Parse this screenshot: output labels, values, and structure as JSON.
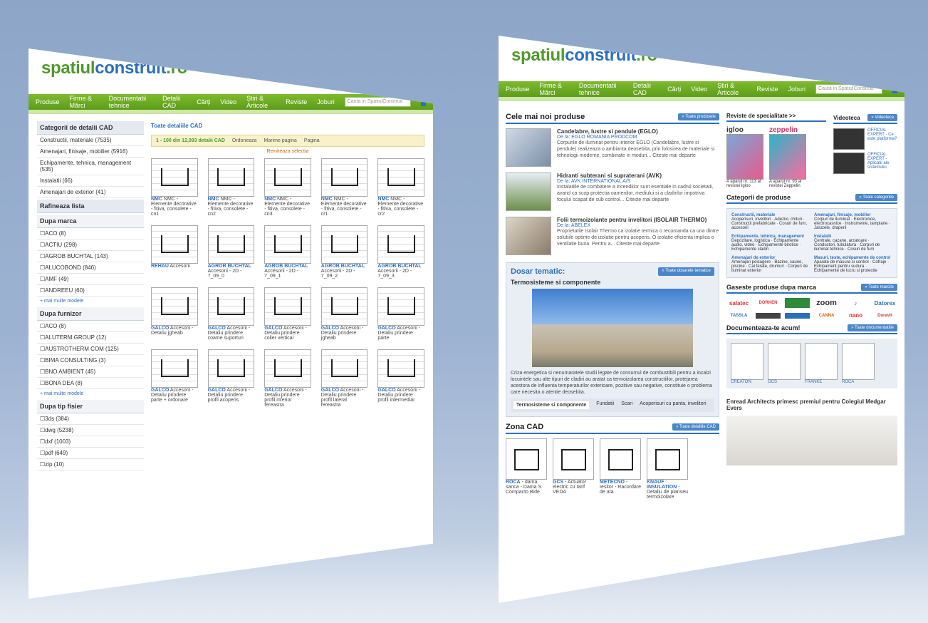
{
  "left": {
    "logo_a": "spatiul",
    "logo_b": "construit",
    "logo_c": ".ro",
    "nav": [
      "Produse",
      "Firme & Mărci",
      "Documentatii tehnice",
      "Detalii CAD",
      "Cărți",
      "Video",
      "Știri & Articole",
      "Reviste",
      "Joburi"
    ],
    "search_placeholder": "Cauta in SpatiulConstruit",
    "sidebar_title": "Categorii de detalii CAD",
    "categories": [
      "Constructii, materiale (7535)",
      "Amenajari, finisaje, mobilier (5916)",
      "Echipamente, tehnica, management (535)",
      "Instalatii (66)",
      "Amenajari de exterior (41)"
    ],
    "refine_title": "Rafineaza lista",
    "by_brand_title": "Dupa marca",
    "brands": [
      "ACO (8)",
      "ACTIU (298)",
      "AGROB BUCHTAL (143)",
      "ALUCOBOND (846)",
      "AMF (49)",
      "ANDREEU (60)"
    ],
    "more": "+ mai multe modele",
    "by_supplier_title": "Dupa furnizor",
    "suppliers": [
      "ACO (8)",
      "ALUTERM GROUP (12)",
      "AUSTROTHERM COM (125)",
      "BIMA CONSULTING (3)",
      "BNO AMBIENT (45)",
      "BONA DEA (8)"
    ],
    "by_filetype_title": "Dupa tip fisier",
    "filetypes": [
      "3ds (384)",
      "dwg (5238)",
      "dxf (1003)",
      "pdf (649)",
      "zip (10)"
    ],
    "crumb": "Toate detaliile CAD",
    "filter_text": "1 - 100 din 12,093 detalii CAD",
    "order_label": "Ordoneaza",
    "results_label": "Marime pagina",
    "page_label": "Pagina",
    "reset": "Reiniteaza selectia",
    "cad_items": [
      {
        "name": "NMC",
        "desc": "NMC - Elemente decorative - fitiva, consolete - cn1"
      },
      {
        "name": "NMC",
        "desc": "NMC - Elemente decorative - fitiva, consolete - cn2"
      },
      {
        "name": "NMC",
        "desc": "NMC - Elemente decorative - fitiva, consolete - cn3"
      },
      {
        "name": "NMC",
        "desc": "NMC - Elemente decorative - fitiva, consolete - cr1"
      },
      {
        "name": "NMC",
        "desc": "NMC - Elemente decorative - fitiva, consolete - cr2"
      },
      {
        "name": "REHAU",
        "desc": "Accesorii"
      },
      {
        "name": "AGROB BUCHTAL",
        "desc": "Accesorii - 2D - 7_09_0"
      },
      {
        "name": "AGROB BUCHTAL",
        "desc": "Accesorii - 2D - 7_09_1"
      },
      {
        "name": "AGROB BUCHTAL",
        "desc": "Accesorii - 2D - 7_09_2"
      },
      {
        "name": "AGROB BUCHTAL",
        "desc": "Accesorii - 2D - 7_09_3"
      },
      {
        "name": "GALCO",
        "desc": "Accesorii - Detaliu jgheab"
      },
      {
        "name": "GALCO",
        "desc": "Accesorii - Detaliu prindere coame suporturi"
      },
      {
        "name": "GALCO",
        "desc": "Accesorii - Detaliu prindere colier vertical"
      },
      {
        "name": "GALCO",
        "desc": "Accesorii - Detaliu prindere jgheab"
      },
      {
        "name": "GALCO",
        "desc": "Accesorii - Detaliu prindere parte"
      },
      {
        "name": "GALCO",
        "desc": "Accesorii - Detaliu prindere parte + ordonare"
      },
      {
        "name": "GALCO",
        "desc": "Accesorii - Detaliu prindere profil acoperis"
      },
      {
        "name": "GALCO",
        "desc": "Accesorii - Detaliu prindere profil inferior fereastra"
      },
      {
        "name": "GALCO",
        "desc": "Accesorii - Detaliu prindere profil lateral fereastra"
      },
      {
        "name": "GALCO",
        "desc": "Accesorii - Detaliu prindere profil intermediar"
      }
    ]
  },
  "right": {
    "logo_a": "spatiul",
    "logo_b": "construit",
    "logo_c": ".ro",
    "nav": [
      "Produse",
      "Firme & Mărci",
      "Documentatii tehnice",
      "Detalii CAD",
      "Cărți",
      "Video",
      "Știri & Articole",
      "Reviste",
      "Joburi"
    ],
    "search_placeholder": "Cauta in SpatiulConstruit",
    "newest_title": "Cele mai noi produse",
    "all_products": "» Toate produsele",
    "products": [
      {
        "title": "Candelabre, lustre si pendule (EGLO)",
        "by": "De la: EGLO ROMANIA PRODCOM",
        "desc": "Corpurile de iluminat pentru interior EGLO (Candelabre, lustre si pendule) realizeaza o ambianta deosebita, prin folosirea de materiale si tehnologii moderne, combinate in moduri... Citeste mai departe"
      },
      {
        "title": "Hidranti subterani si supraterani (AVK)",
        "by": "De la: AVK INTERNATIONAL A/S",
        "desc": "Instalatiile de combatere a incendiilor sunt esentiale in cadrul societatii, avand ca scop protectia oamenilor, mediului si a cladirilor impotriva focului scapat de sub control... Citeste mai departe"
      },
      {
        "title": "Folii termoizolante pentru invelitori (ISOLAIR THERMO)",
        "by": "De la: ABELEX",
        "desc": "Proprietatile Isolair Thermo ca izolatie termica o recomanda ca una dintre solutiile optime de izolatie pentru acoperis. O izolatie eficienta implica o ventilatie buna. Pentru a... Citeste mai departe"
      }
    ],
    "dosar_title": "Dosar tematic:",
    "dosar_btn": "» Toate dosarele tematice",
    "dosar_subtitle": "Termosisteme si componente",
    "dosar_text": "Criza energetica si nenumaratele studii legate de consumul de combustibili pentru a incalzi locuintele sau alte tipuri de cladiri au aratat ca termoizolarea constructiilor, protejarea acestora de influenta temperaturilor exterioare, pozitive sau negative, constituie o problema care necesita o atentie deosebita.",
    "tabs": [
      "Termosisteme si componente",
      "Fundatii",
      "Scari",
      "Acoperisuri cu panta, invelitori"
    ],
    "cad_zone_title": "Zona CAD",
    "cad_zone_btn": "» Toate detaliile CAD",
    "cad_zone": [
      {
        "name": "ROCA",
        "desc": "- dama sanca - Dama S Compacto Bide"
      },
      {
        "name": "GCS",
        "desc": "- Actuator electric cu tarif VEDA"
      },
      {
        "name": "METECNO",
        "desc": "- Iesitor - Racordare de ata"
      },
      {
        "name": "KNAUF INSULATION",
        "desc": "- Detaliu de planseu termoizolare"
      }
    ],
    "mags_title": "Reviste de specialitate >>",
    "mags": [
      {
        "name": "igloo",
        "desc": "A aparut nr. 113 al revistei Igloo"
      },
      {
        "name": "zeppelin",
        "desc": "A aparut nr. 93 al revistei Zeppelin"
      }
    ],
    "video_title": "Videoteca",
    "video_btn": "» Videoteca",
    "videos": [
      "OFFICIAL EXPERT - Ce este platforma?",
      "OFFICIAL EXPERT - Aplicatii ale sistemului"
    ],
    "cats_title": "Categorii de produse",
    "cats_btn": "» Toate categoriile",
    "cat_groups": [
      {
        "head": "Constructii, materiale",
        "items": "Acoperisuri, invelitori · Adezivi, chituri · Constructii prefabricate · Cosuri de fum, accesorii"
      },
      {
        "head": "Amenajari, finisaje, mobilier",
        "items": "Corpuri de iluminat · Electronice, electrocasnice · Instrumente, tamplarie · Jaluzele, draperii"
      },
      {
        "head": "Echipamente, tehnica, management",
        "items": "Depozitare, logistica · Echipamente audio, video · Echipamente birotice · Echipamente cladiri"
      },
      {
        "head": "Instalatii",
        "items": "Centrale, cazane, arzatoare · Conductori, tubulatura · Corpuri de iluminat tehnice · Cosuri de fum"
      },
      {
        "head": "Amenajari de exterior",
        "items": "Amenajari peisagere · Bazine, saune, piscine · Cai ferate, drumuri · Corpuri de iluminat exterior"
      },
      {
        "head": "Masuri, teste, echipamente de control",
        "items": "Aparate de masura si control · Cofraje · Echipament pentru sudura · Echipamente de lucru si protectie"
      }
    ],
    "brands_title": "Gaseste produse dupa marca",
    "brands_btn": "» Toate marcile",
    "brand_logos": [
      "salatec",
      "DORKEN",
      "",
      "zoom",
      "",
      "Datorex",
      "TASSLA",
      "",
      "",
      "CANNA",
      "nano",
      "Duravit"
    ],
    "docs_title": "Documenteaza-te acum!",
    "docs_btn": "» Toate documentatiile",
    "docs": [
      "CREATON",
      "GCS",
      "FRANKE",
      "ROCA"
    ],
    "news_title": "Enread Architects primesc premiul pentru Colegiul Medgar Evers"
  }
}
